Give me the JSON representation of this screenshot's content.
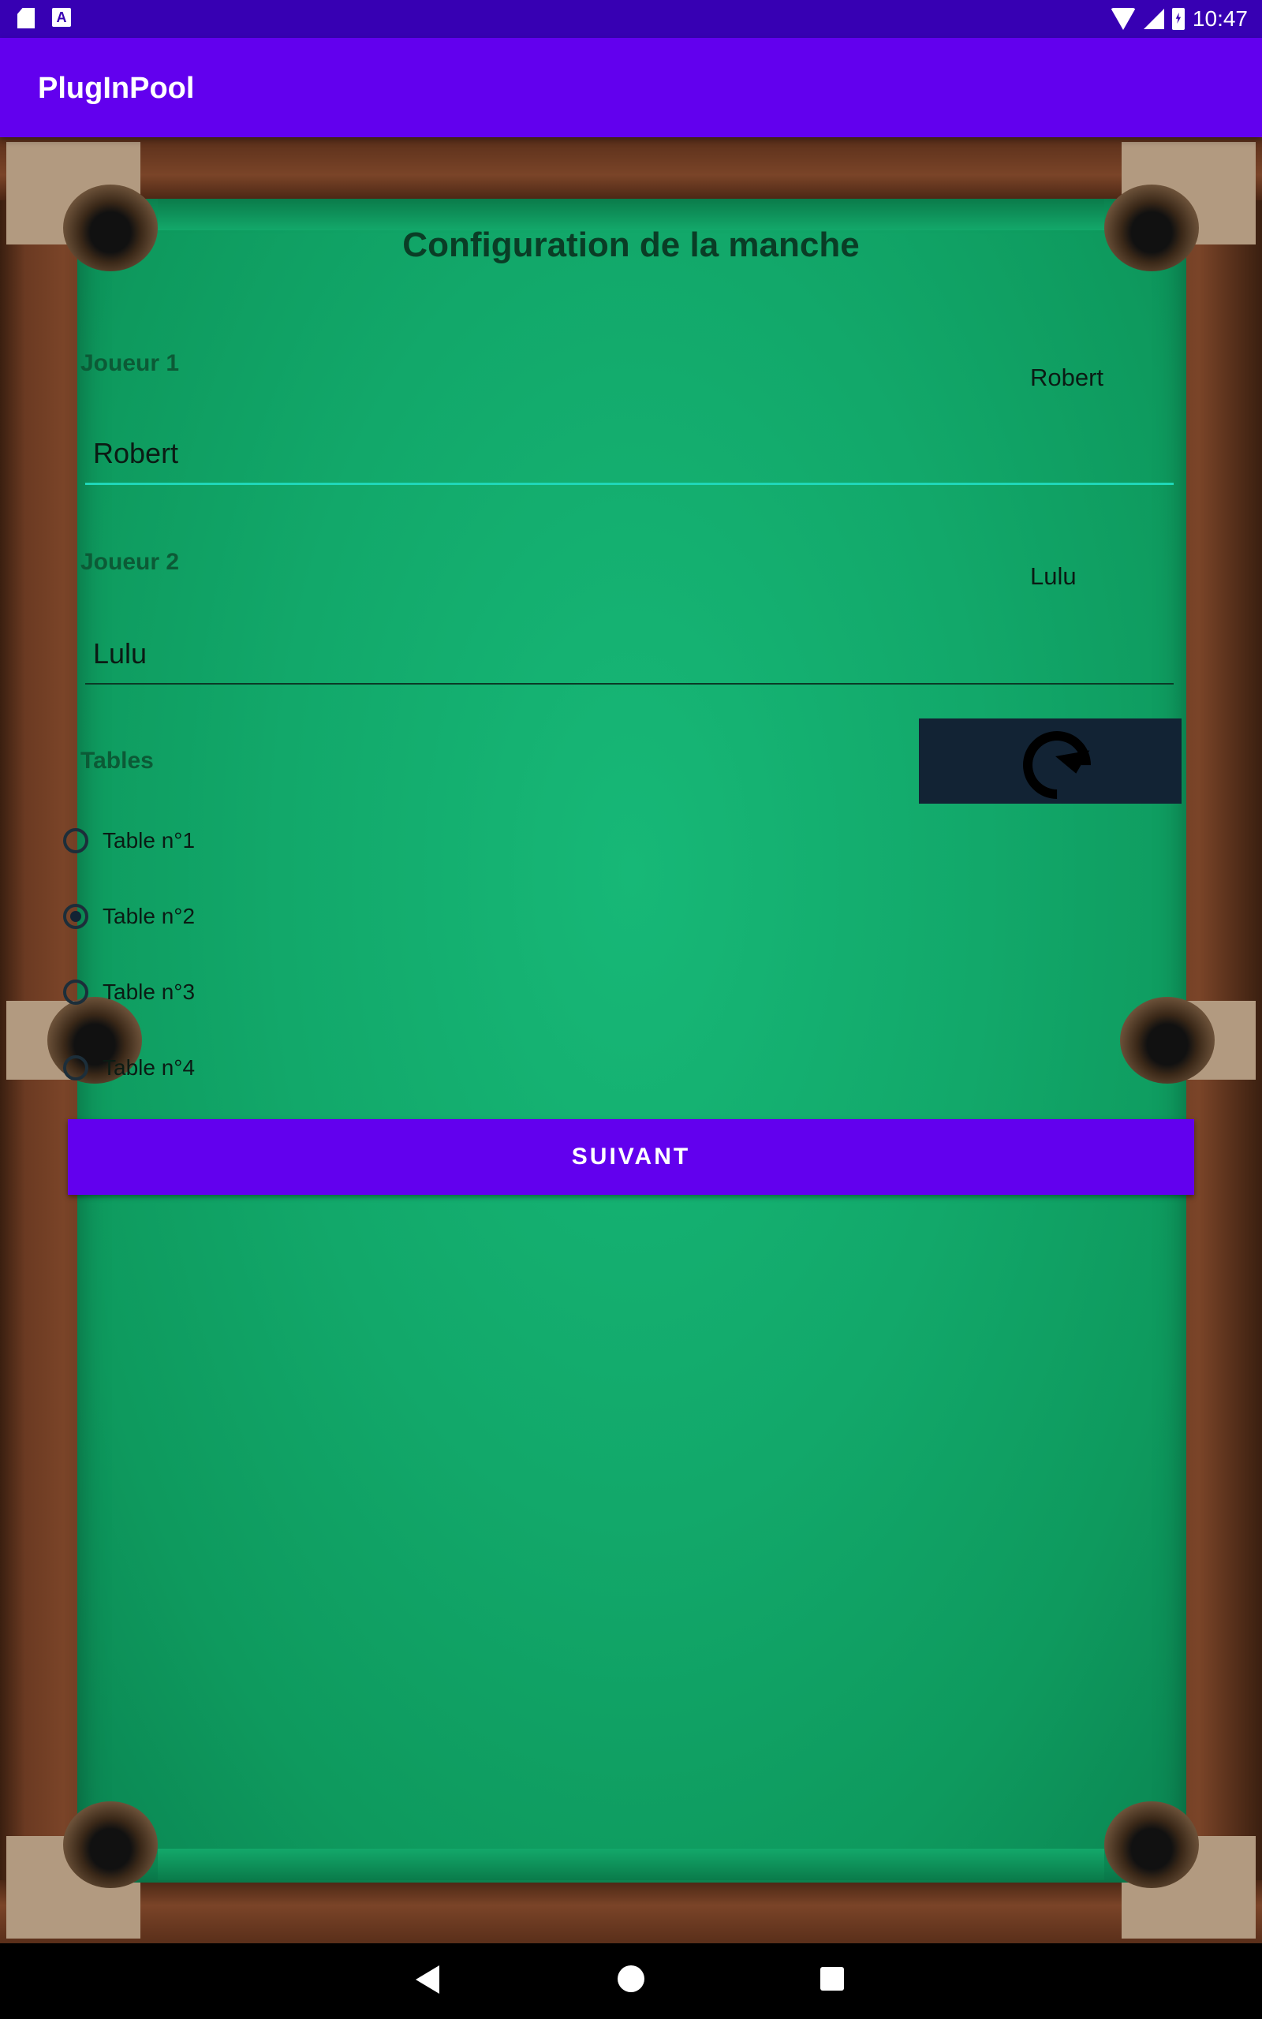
{
  "status_bar": {
    "time": "10:47"
  },
  "app_bar": {
    "title": "PlugInPool"
  },
  "form": {
    "title": "Configuration de la manche",
    "player1": {
      "label": "Joueur 1",
      "side_value": "Robert",
      "input_value": "Robert"
    },
    "player2": {
      "label": "Joueur 2",
      "side_value": "Lulu",
      "input_value": "Lulu"
    },
    "tables": {
      "label": "Tables",
      "options": [
        "Table n°1",
        "Table n°2",
        "Table n°3",
        "Table n°4"
      ],
      "selected_index": 1
    },
    "next_button_label": "SUIVANT"
  },
  "icons": {
    "status": [
      "sd-card-icon",
      "font-icon",
      "wifi-icon",
      "signal-icon",
      "battery-charging-icon"
    ],
    "refresh": "refresh-icon",
    "nav": [
      "back-icon",
      "home-icon",
      "recents-icon"
    ]
  },
  "colors": {
    "status_bar": "#3700b3",
    "app_bar": "#6200ee",
    "button": "#6200ee",
    "felt": "#13a86a",
    "refresh_button": "#122334",
    "focused_underline": "#1fd7b8"
  }
}
